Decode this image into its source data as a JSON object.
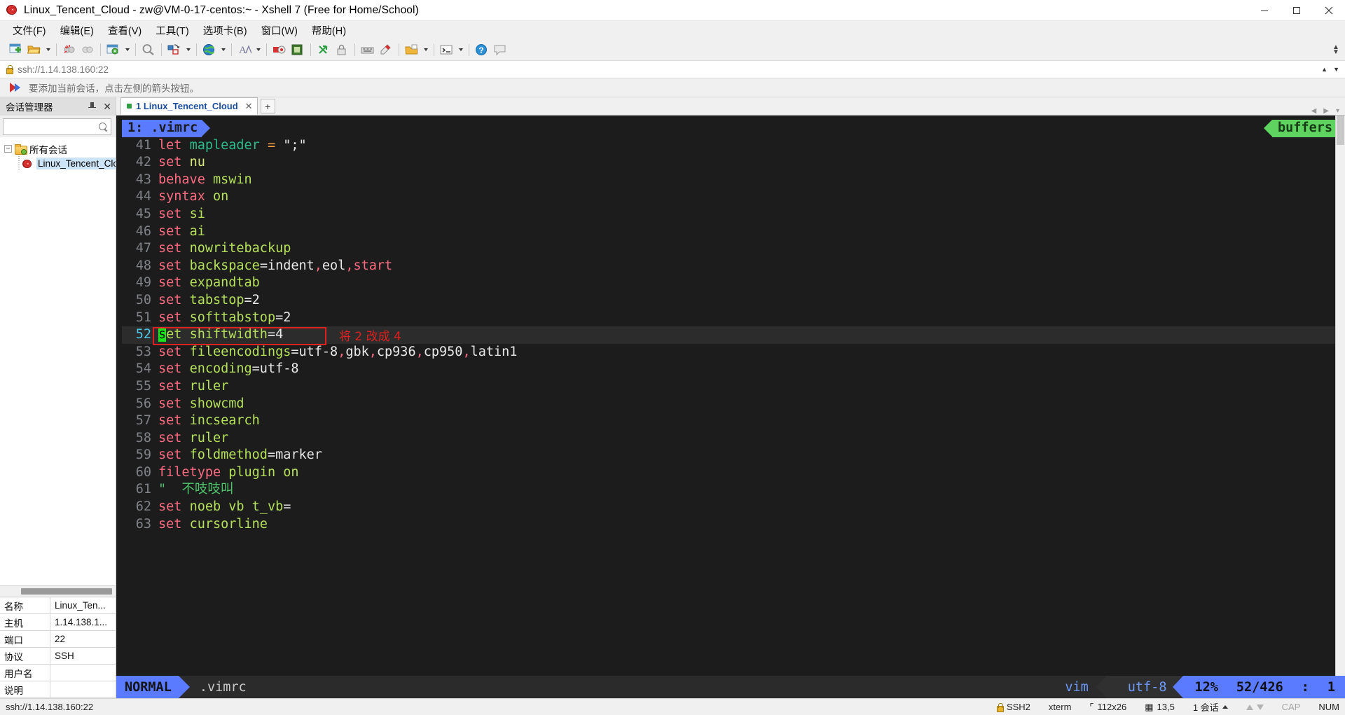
{
  "window": {
    "title": "Linux_Tencent_Cloud - zw@VM-0-17-centos:~ - Xshell 7 (Free for Home/School)",
    "app_icon": "xshell-icon",
    "minimize": "–",
    "maximize": "❐",
    "close": "✕"
  },
  "menu": {
    "items": [
      {
        "label": "文件(F)",
        "name": "menu-file"
      },
      {
        "label": "编辑(E)",
        "name": "menu-edit"
      },
      {
        "label": "查看(V)",
        "name": "menu-view"
      },
      {
        "label": "工具(T)",
        "name": "menu-tools"
      },
      {
        "label": "选项卡(B)",
        "name": "menu-tabs"
      },
      {
        "label": "窗口(W)",
        "name": "menu-window"
      },
      {
        "label": "帮助(H)",
        "name": "menu-help"
      }
    ]
  },
  "toolbar": {
    "overflow_label": "»",
    "icons": [
      "new-session-icon",
      "open-folder-icon",
      "disconnect-icon",
      "reconnect-icon",
      "session-properties-icon",
      "find-icon",
      "layout-icon",
      "globe-icon",
      "font-icon",
      "record-icon",
      "log-icon",
      "transfer-icon",
      "lock-icon",
      "keyboard-icon",
      "highlight-icon",
      "compose-icon",
      "quick-command-icon",
      "help-icon",
      "chat-icon"
    ]
  },
  "address": {
    "value": "ssh://1.14.138.160:22",
    "icon": "lock-icon"
  },
  "notice": {
    "icon": "red-blue-arrow-icon",
    "text": "要添加当前会话，点击左侧的箭头按钮。"
  },
  "sidebar": {
    "title": "会话管理器",
    "pin_icon": "pin-icon",
    "close_icon": "close-icon",
    "search": {
      "value": "",
      "placeholder": "",
      "icon": "search-icon"
    },
    "tree": {
      "root": {
        "label": "所有会话",
        "expander": "−",
        "icon": "folder-icon"
      },
      "children": [
        {
          "label": "Linux_Tencent_Clo",
          "icon": "session-icon",
          "selected": true
        }
      ]
    },
    "properties": {
      "rows": [
        {
          "key": "名称",
          "value": "Linux_Ten..."
        },
        {
          "key": "主机",
          "value": "1.14.138.1..."
        },
        {
          "key": "端口",
          "value": "22"
        },
        {
          "key": "协议",
          "value": "SSH"
        },
        {
          "key": "用户名",
          "value": ""
        },
        {
          "key": "说明",
          "value": ""
        }
      ]
    }
  },
  "tabs": {
    "items": [
      {
        "label": "1 Linux_Tencent_Cloud",
        "active": true,
        "close": "✕",
        "status_dot": "#2f9e44"
      }
    ],
    "new_tab_label": "+",
    "nav_prev": "◀",
    "nav_next": "▶",
    "nav_menu": "▾"
  },
  "terminal": {
    "buffers_badge": "buffers",
    "buffer_tag": "1: .vimrc",
    "lines": [
      {
        "n": "41",
        "tokens": [
          {
            "t": "let ",
            "c": "kw"
          },
          {
            "t": "mapleader ",
            "c": "ident"
          },
          {
            "t": "= ",
            "c": "op"
          },
          {
            "t": "\";\"",
            "c": "str"
          }
        ]
      },
      {
        "n": "42",
        "tokens": [
          {
            "t": "set ",
            "c": "kw"
          },
          {
            "t": "nu",
            "c": "opt2"
          }
        ]
      },
      {
        "n": "43",
        "tokens": [
          {
            "t": "behave ",
            "c": "kw"
          },
          {
            "t": "mswin",
            "c": "opt"
          }
        ]
      },
      {
        "n": "44",
        "tokens": [
          {
            "t": "syntax ",
            "c": "kw"
          },
          {
            "t": "on",
            "c": "opt"
          }
        ]
      },
      {
        "n": "45",
        "tokens": [
          {
            "t": "set ",
            "c": "kw"
          },
          {
            "t": "si",
            "c": "opt"
          }
        ]
      },
      {
        "n": "46",
        "tokens": [
          {
            "t": "set ",
            "c": "kw"
          },
          {
            "t": "ai",
            "c": "opt"
          }
        ]
      },
      {
        "n": "47",
        "tokens": [
          {
            "t": "set ",
            "c": "kw"
          },
          {
            "t": "nowritebackup",
            "c": "opt"
          }
        ]
      },
      {
        "n": "48",
        "tokens": [
          {
            "t": "set ",
            "c": "kw"
          },
          {
            "t": "backspace",
            "c": "opt"
          },
          {
            "t": "=",
            "c": "val"
          },
          {
            "t": "indent",
            "c": "val"
          },
          {
            "t": ",",
            "c": "punc"
          },
          {
            "t": "eol",
            "c": "val"
          },
          {
            "t": ",",
            "c": "punc"
          },
          {
            "t": "start",
            "c": "kw"
          }
        ]
      },
      {
        "n": "49",
        "tokens": [
          {
            "t": "set ",
            "c": "kw"
          },
          {
            "t": "expandtab",
            "c": "opt"
          }
        ]
      },
      {
        "n": "50",
        "tokens": [
          {
            "t": "set ",
            "c": "kw"
          },
          {
            "t": "tabstop",
            "c": "opt"
          },
          {
            "t": "=2",
            "c": "val"
          }
        ]
      },
      {
        "n": "51",
        "tokens": [
          {
            "t": "set ",
            "c": "kw"
          },
          {
            "t": "softtabstop",
            "c": "opt"
          },
          {
            "t": "=2",
            "c": "val"
          }
        ]
      },
      {
        "n": "52",
        "current": true,
        "cursor_char": "s",
        "tokens": [
          {
            "t": "et ",
            "c": "opt"
          },
          {
            "t": "shiftwidth",
            "c": "opt"
          },
          {
            "t": "=4",
            "c": "val"
          }
        ]
      },
      {
        "n": "53",
        "tokens": [
          {
            "t": "set ",
            "c": "kw"
          },
          {
            "t": "fileencodings",
            "c": "opt"
          },
          {
            "t": "=utf-8",
            "c": "val"
          },
          {
            "t": ",",
            "c": "punc"
          },
          {
            "t": "gbk",
            "c": "val"
          },
          {
            "t": ",",
            "c": "punc"
          },
          {
            "t": "cp936",
            "c": "val"
          },
          {
            "t": ",",
            "c": "punc"
          },
          {
            "t": "cp950",
            "c": "val"
          },
          {
            "t": ",",
            "c": "punc"
          },
          {
            "t": "latin1",
            "c": "val"
          }
        ]
      },
      {
        "n": "54",
        "tokens": [
          {
            "t": "set ",
            "c": "kw"
          },
          {
            "t": "encoding",
            "c": "opt"
          },
          {
            "t": "=utf-8",
            "c": "val"
          }
        ]
      },
      {
        "n": "55",
        "tokens": [
          {
            "t": "set ",
            "c": "kw"
          },
          {
            "t": "ruler",
            "c": "opt"
          }
        ]
      },
      {
        "n": "56",
        "tokens": [
          {
            "t": "set ",
            "c": "kw"
          },
          {
            "t": "showcmd",
            "c": "opt"
          }
        ]
      },
      {
        "n": "57",
        "tokens": [
          {
            "t": "set ",
            "c": "kw"
          },
          {
            "t": "incsearch",
            "c": "opt"
          }
        ]
      },
      {
        "n": "58",
        "tokens": [
          {
            "t": "set ",
            "c": "kw"
          },
          {
            "t": "ruler",
            "c": "opt"
          }
        ]
      },
      {
        "n": "59",
        "tokens": [
          {
            "t": "set ",
            "c": "kw"
          },
          {
            "t": "foldmethod",
            "c": "opt"
          },
          {
            "t": "=marker",
            "c": "val"
          }
        ]
      },
      {
        "n": "60",
        "tokens": [
          {
            "t": "filetype ",
            "c": "kw"
          },
          {
            "t": "plugin ",
            "c": "opt"
          },
          {
            "t": "on",
            "c": "opt"
          }
        ]
      },
      {
        "n": "61",
        "tokens": [
          {
            "t": "\"  不吱吱叫",
            "c": "comment"
          }
        ]
      },
      {
        "n": "62",
        "tokens": [
          {
            "t": "set ",
            "c": "kw"
          },
          {
            "t": "noeb vb t_vb",
            "c": "opt"
          },
          {
            "t": "=",
            "c": "val"
          }
        ]
      },
      {
        "n": "63",
        "tokens": [
          {
            "t": "set ",
            "c": "kw"
          },
          {
            "t": "cursorline",
            "c": "opt"
          }
        ]
      }
    ],
    "annotation": {
      "text": "将 2 改成 4",
      "box_color": "#e02020"
    },
    "statusline": {
      "mode": "NORMAL",
      "file": ".vimrc",
      "filetype": "vim",
      "encoding": "utf-8",
      "percent": "12%",
      "position": "52/426",
      "separator": ":",
      "column": "1"
    }
  },
  "statusbar": {
    "connection": "ssh://1.14.138.160:22",
    "protocol": "SSH2",
    "term_type": "xterm",
    "size": "112x26",
    "cursor": "13,5",
    "sessions": "1 会话",
    "cap": "CAP",
    "num": "NUM"
  }
}
